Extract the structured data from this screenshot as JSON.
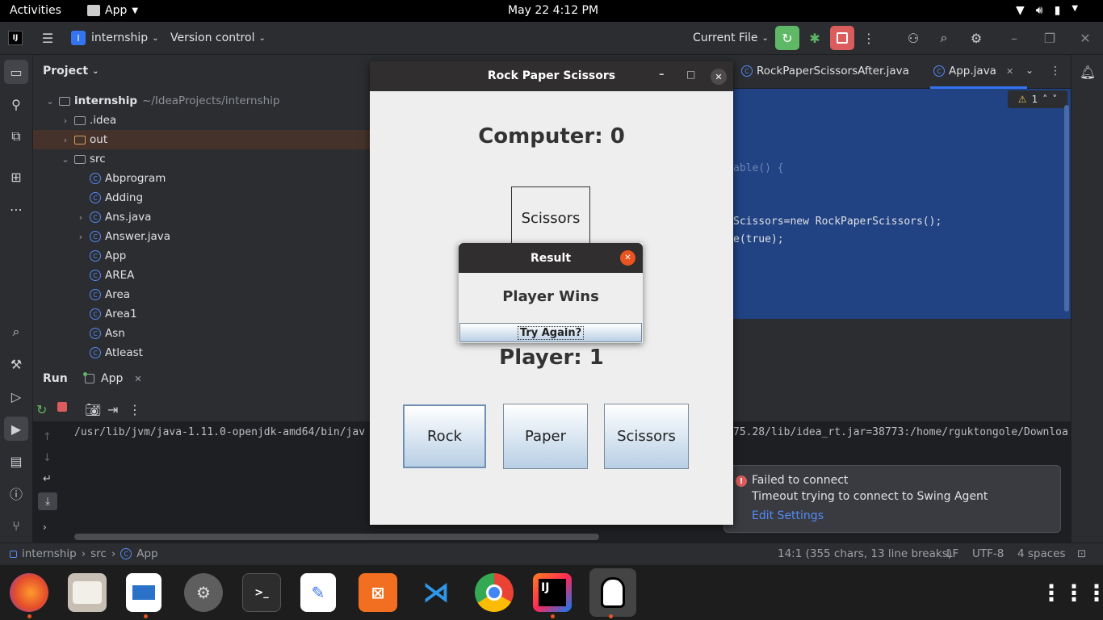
{
  "topbar": {
    "activities": "Activities",
    "app_menu": "App",
    "clock": "May 22   4:12 PM"
  },
  "ide": {
    "project_name": "internship",
    "vcs": "Version control",
    "run_config": "Current File",
    "panel_title": "Project",
    "tree": [
      {
        "label": "internship",
        "extra": "~/IdeaProjects/internship",
        "kind": "folder",
        "depth": 0,
        "arrow": "down"
      },
      {
        "label": ".idea",
        "kind": "folder",
        "depth": 1,
        "arrow": "right"
      },
      {
        "label": "out",
        "kind": "folder-orange",
        "depth": 1,
        "arrow": "right"
      },
      {
        "label": "src",
        "kind": "folder",
        "depth": 1,
        "arrow": "down"
      },
      {
        "label": "Abprogram",
        "kind": "class",
        "depth": 2,
        "arrow": ""
      },
      {
        "label": "Adding",
        "kind": "class",
        "depth": 2,
        "arrow": ""
      },
      {
        "label": "Ans.java",
        "kind": "class",
        "depth": 2,
        "arrow": "right"
      },
      {
        "label": "Answer.java",
        "kind": "class",
        "depth": 2,
        "arrow": "right"
      },
      {
        "label": "App",
        "kind": "class",
        "depth": 2,
        "arrow": ""
      },
      {
        "label": "AREA",
        "kind": "class",
        "depth": 2,
        "arrow": ""
      },
      {
        "label": "Area",
        "kind": "class",
        "depth": 2,
        "arrow": ""
      },
      {
        "label": "Area1",
        "kind": "class",
        "depth": 2,
        "arrow": ""
      },
      {
        "label": "Asn",
        "kind": "class",
        "depth": 2,
        "arrow": ""
      },
      {
        "label": "Atleast",
        "kind": "class",
        "depth": 2,
        "arrow": ""
      }
    ],
    "tabs": [
      {
        "label": "RockPaperScissorsAfter.java"
      },
      {
        "label": "App.java"
      }
    ],
    "warning_count": "1",
    "code": [
      "able() {",
      "Scissors=new RockPaperScissors();",
      "e(true);"
    ],
    "run_tab": "Run",
    "run_config_tab": "App",
    "run_output_left": "/usr/lib/jvm/java-1.11.0-openjdk-amd64/bin/jav",
    "run_output_right": "75.28/lib/idea_rt.jar=38773:/home/rguktongole/Downloa",
    "notification": {
      "title": "Failed to connect",
      "body": "Timeout trying to connect to Swing Agent",
      "link": "Edit Settings"
    },
    "status": {
      "crumb1": "internship",
      "crumb2": "src",
      "crumb3": "App",
      "position": "14:1 (355 chars, 13 line breaks)",
      "line_sep": "LF",
      "encoding": "UTF-8",
      "indent": "4 spaces"
    }
  },
  "game": {
    "title": "Rock Paper Scissors",
    "computer_score": "Computer: 0",
    "computer_choice": "Scissors",
    "player_score": "Player: 1",
    "buttons": [
      "Rock",
      "Paper",
      "Scissors"
    ]
  },
  "dialog": {
    "title": "Result",
    "message": "Player Wins",
    "button": "Try Again?"
  },
  "colors": {
    "accent": "#548af7",
    "editor_selection": "#214283",
    "ubuntu_orange": "#e95420"
  }
}
